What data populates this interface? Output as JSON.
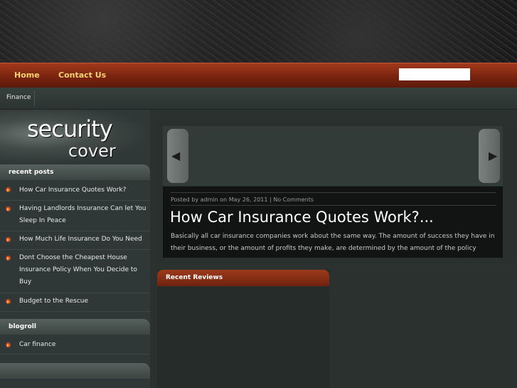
{
  "nav": {
    "home": "Home",
    "contact": "Contact Us",
    "search_value": ""
  },
  "category": "Finance",
  "logo": {
    "line1": "security",
    "line2": "cover"
  },
  "sidebar": {
    "recent_posts_title": "recent posts",
    "recent_posts": [
      "How Car Insurance Quotes Work?",
      "Having Landlords Insurance Can let You Sleep In Peace",
      "How Much Life Insurance Do You Need",
      "Dont Choose the Cheapest House Insurance Policy When You Decide to Buy",
      "Budget to the Rescue"
    ],
    "blogroll_title": "blogroll",
    "blogroll": [
      "Car finance"
    ],
    "third_title": ""
  },
  "featured": {
    "meta": "Posted by admin on May 26, 2011 | No Comments",
    "title": "How Car Insurance Quotes Work?...",
    "excerpt": "Basically all car insurance companies work about the same way. The amount of success they have in their business, or the amount of profits they make, are determined by the amount of the policy"
  },
  "reviews": {
    "title": "Recent Reviews"
  },
  "colors": {
    "nav": "#7a2410",
    "nav_text": "#f6d470",
    "bullet": "#c84b1f"
  }
}
